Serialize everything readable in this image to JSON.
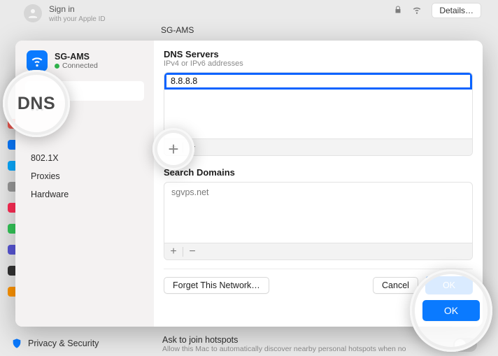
{
  "bg": {
    "signin_label": "Sign in",
    "signin_sub": "with your Apple ID",
    "network_name": "SG-AMS",
    "details_btn": "Details…",
    "privacy_label": "Privacy & Security",
    "hotspot_title": "Ask to join hotspots",
    "hotspot_sub": "Allow this Mac to automatically discover nearby personal hotspots when no"
  },
  "modal": {
    "network_name": "SG-AMS",
    "status_label": "Connected",
    "sidebar": {
      "highlight_label": "DNS",
      "items": [
        "802.1X",
        "Proxies",
        "Hardware"
      ]
    },
    "dns": {
      "title": "DNS Servers",
      "subtitle": "IPv4 or IPv6 addresses",
      "editing_value": "8.8.8.8",
      "add_label": "+",
      "remove_label": "−"
    },
    "search_domains": {
      "title": "Search Domains",
      "items": [
        "sgvps.net"
      ],
      "add_label": "+",
      "remove_label": "−"
    },
    "footer": {
      "forget_label": "Forget This Network…",
      "cancel_label": "Cancel",
      "ok_label": "OK"
    }
  }
}
